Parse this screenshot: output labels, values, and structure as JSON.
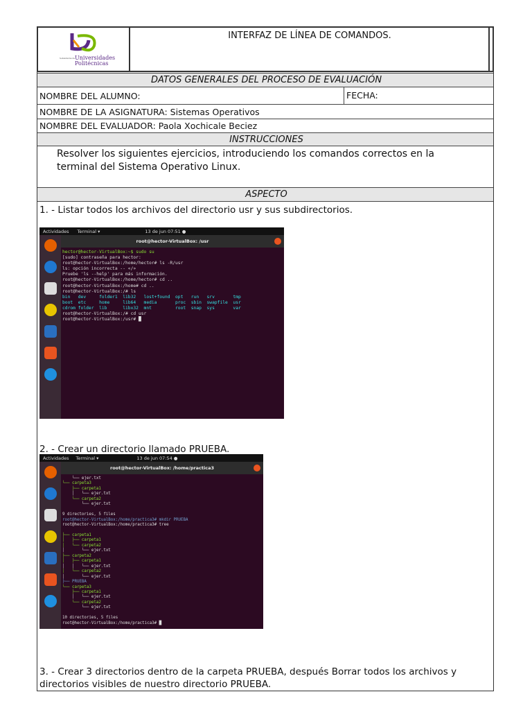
{
  "header": {
    "title": "INTERFAZ DE LÍNEA DE COMANDOS.",
    "logo_text": "Universidades Politécnicas",
    "logo_small": "Subsistema de"
  },
  "general": {
    "section": "DATOS GENERALES DEL PROCESO DE EVALUACIÓN",
    "alumno": "NOMBRE DEL ALUMNO:",
    "fecha": "FECHA:",
    "asignatura": "NOMBRE DE LA ASIGNATURA: Sistemas Operativos",
    "evaluador": "NOMBRE DEL EVALUADOR: Paola Xochicale Beciez"
  },
  "instrucciones": {
    "section": "INSTRUCCIONES",
    "text": "Resolver los siguientes ejercicios, introduciendo los comandos correctos en la terminal del Sistema Operativo Linux."
  },
  "aspecto": {
    "section": "ASPECTO"
  },
  "items": [
    {
      "text": "1.  - Listar todos los archivos del directorio usr y sus subdirectorios."
    },
    {
      "text": "2.  - Crear un directorio llamado PRUEBA."
    },
    {
      "text": "3.  - Crear 3 directorios dentro de la carpeta PRUEBA, después Borrar todos los archivos y directorios visibles de nuestro directorio PRUEBA."
    }
  ],
  "term1": {
    "activities": "Actividades",
    "app": "Terminal ▾",
    "clock": "13 de jun 07:51 ●",
    "title": "root@hector-VirtualBox: /usr",
    "lines": [
      "hector@hector-VirtualBox:~$ sudo su",
      "[sudo] contraseña para hector:",
      "root@hector-VirtualBox:/home/hector# ls -R/usr",
      "ls: opción incorrecta -- «/»",
      "Pruebe 'ls --help' para más información.",
      "root@hector-VirtualBox:/home/hector# cd ..",
      "root@hector-VirtualBox:/home# cd ..",
      "root@hector-VirtualBox:/# ls",
      "bin   dev     folder1  lib32   lost+found  opt   run   srv       tmp",
      "boot  etc     home     lib64   media       proc  sbin  swapfile  usr",
      "cdrom folder  lib      libx32  mnt         root  snap  sys       var",
      "root@hector-VirtualBox:/# cd usr",
      "root@hector-VirtualBox:/usr# █"
    ]
  },
  "term2": {
    "activities": "Actividades",
    "app": "Terminal ▾",
    "clock": "13 de jun 07:54 ●",
    "title": "root@hector-VirtualBox: /home/practica3",
    "lines": [
      "    └── ejer.txt",
      "└── carpeta3",
      "    ├── carpeta1",
      "    │   └── ejer.txt",
      "    └── carpeta2",
      "        └── ejer.txt",
      "",
      "9 directories, 5 files",
      "root@hector-VirtualBox:/home/practica3# mkdir PRUEBA",
      "root@hector-VirtualBox:/home/practica3# tree",
      "",
      "├── carpeta1",
      "│   ├── carpeta1",
      "│   └── carpeta2",
      "│       └── ejer.txt",
      "├── carpeta2",
      "│   ├── carpeta1",
      "│   │   └── ejer.txt",
      "│   └── carpeta2",
      "│       └── ejer.txt",
      "├── PRUEBA",
      "└── carpeta3",
      "    ├── carpeta1",
      "    │   └── ejer.txt",
      "    └── carpeta2",
      "        └── ejer.txt",
      "",
      "10 directories, 5 files",
      "root@hector-VirtualBox:/home/practica3# █"
    ]
  }
}
